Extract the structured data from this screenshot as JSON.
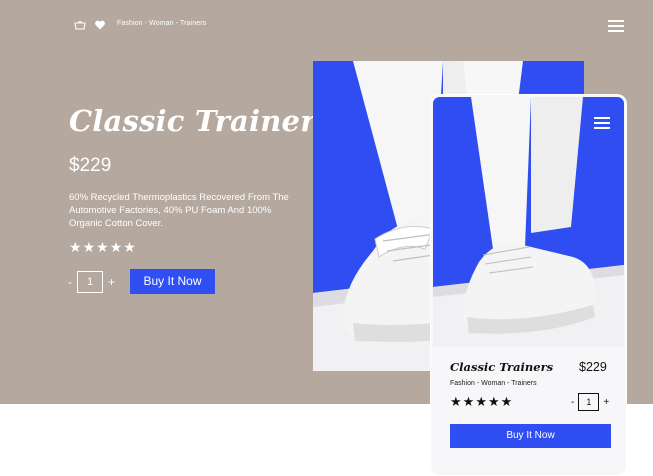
{
  "header": {
    "breadcrumb": "Fashion - Woman - Trainers",
    "icons": [
      "basket-icon",
      "heart-icon",
      "menu-icon"
    ]
  },
  "product": {
    "title": "Classic Trainers",
    "price": "$229",
    "description": "60% Recycled Thermoplastics Recovered From The Automotive Factories, 40% PU Foam And 100% Organic Cotton Cover.",
    "rating": 5,
    "stars": [
      "★",
      "★",
      "★",
      "★",
      "★"
    ],
    "quantity": {
      "minus": "-",
      "value": "1",
      "plus": "+"
    },
    "buy_label": "Buy It Now"
  },
  "mobile_card": {
    "title": "Classic Trainers",
    "price": "$229",
    "breadcrumb": "Fashion - Woman - Trainers",
    "stars": [
      "★",
      "★",
      "★",
      "★",
      "★"
    ],
    "quantity": {
      "minus": "-",
      "value": "1",
      "plus": "+"
    },
    "buy_label": "Buy It Now"
  },
  "colors": {
    "background": "#b5a89f",
    "accent": "#2f4ff2",
    "photo_blue": "#2f4df0",
    "card": "#f7f7f9"
  }
}
